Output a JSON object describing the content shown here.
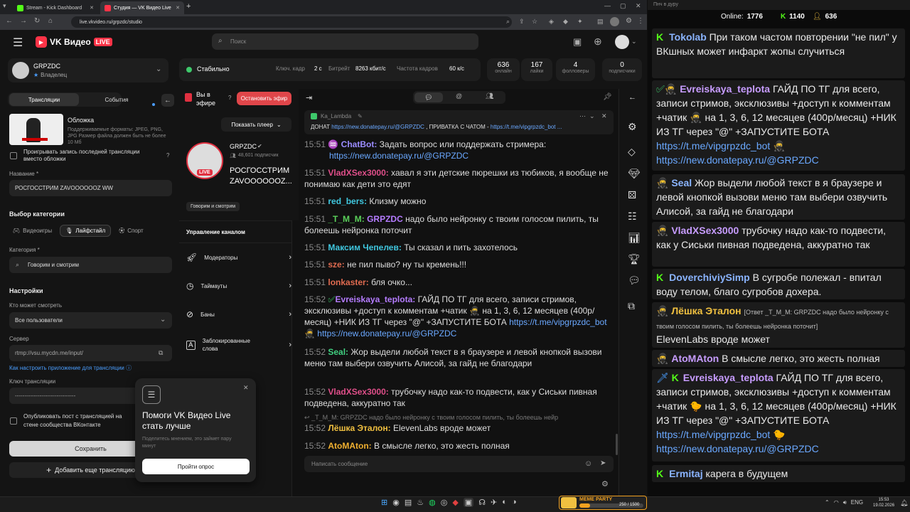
{
  "browser": {
    "tabs": [
      {
        "label": "Stream - Kick Dashboard"
      },
      {
        "label": "Студия — VK Видео Live"
      }
    ],
    "url": "live.vkvideo.ru/grpzdc/studio"
  },
  "header": {
    "logo": "VK Видео",
    "logo_badge": "LIVE",
    "search_placeholder": "Поиск"
  },
  "account": {
    "name": "GRPZDC",
    "role": "Владелец"
  },
  "status": {
    "state": "Стабильно",
    "keyframe_label": "Ключ. кадр",
    "keyframe_value": "2 с",
    "bitrate_label": "Битрейт",
    "bitrate_value": "8263 кбит/с",
    "fps_label": "Частота кадров",
    "fps_value": "60 к/с"
  },
  "stats": [
    {
      "value": "636",
      "label": "онлайн"
    },
    {
      "value": "167",
      "label": "лайки"
    },
    {
      "value": "4",
      "label": "фолловеры"
    },
    {
      "value": "0",
      "label": "подписчики"
    }
  ],
  "left": {
    "tabs": [
      "Трансляции",
      "События"
    ],
    "cover_title": "Обложка",
    "cover_desc": "Поддерживаемые форматы: JPEG, PNG, JPG Размер файла должен быть не более 10 Мб",
    "replay_checkbox": "Проигрывать запись последней трансляции вместо обложки",
    "name_label": "Название *",
    "name_value": "РОСГОССТРИМ ZAVOOOOOOZ WW",
    "category_section": "Выбор категории",
    "cat_tabs": [
      "Видеоигры",
      "Лайфстайл",
      "Спорт"
    ],
    "category_label": "Категория *",
    "category_value": "Говорим и смотрим",
    "settings": "Настройки",
    "who_label": "Кто может смотреть",
    "who_value": "Все пользователи",
    "server_label": "Сервер",
    "server_value": "rtmp://vsu.mycdn.me/input/",
    "howto": "Как настроить приложение для трансляции",
    "key_label": "Ключ трансляции",
    "key_value": "--------------------------------",
    "publish": "Опубликовать пост с трансляцией на стене сообщества ВКонтакте",
    "save": "Сохранить",
    "add": "Добавить еще трансляцию"
  },
  "mid": {
    "live_label": "Вы в эфире",
    "stop": "Остановить эфир",
    "show_player": "Показать плеер",
    "channel": "GRPZDC",
    "subs": "48,601 подписчик",
    "live_badge": "LIVE",
    "title1": "РОСГОССТРИМ",
    "title2": "ZAVOOOOOOZ...",
    "tag": "Говорим и смотрим",
    "manage": "Управление каналом",
    "menu": [
      "Модераторы",
      "Таймауты",
      "Баны",
      "Заблокированные слова"
    ]
  },
  "popup": {
    "title1": "Помоги VK Видео Live",
    "title2": "стать лучше",
    "desc": "Поделитесь мнением, это займет пару минут",
    "button": "Пройти опрос"
  },
  "chat": {
    "pinned_author": "Ka_Lambda",
    "pinned_text1": "ДОНАТ ",
    "pinned_link1": "https://new.donatepay.ru/@GRPZDC",
    "pinned_text2": " , ПРИВАТКА С ЧАТОМ - ",
    "pinned_link2": "https://t.me/vipgrpzdc_bot ...",
    "messages": [
      {
        "time": "15:51",
        "user": "ChatBot:",
        "text": "Задать вопрос или поддержать стримера:",
        "link": "https://new.donatepay.ru/@GRPZDC",
        "color": "#9b8cff"
      },
      {
        "time": "15:51",
        "user": "VladXSex3000:",
        "text": "хавал я эти детские пюрешки из тюбиков, я вообще не понимаю как дети это едят",
        "color": "#e04f8a"
      },
      {
        "time": "15:51",
        "user": "red_bers:",
        "text": "Клизму можно",
        "color": "#40c8e0"
      },
      {
        "time": "15:51",
        "user": "_T_M_M:",
        "mention": "GRPZDC",
        "text": "надо было нейронку с твоим голосом пилить, ты болеешь нейронка поточит",
        "color": "#5ad05a"
      },
      {
        "time": "15:51",
        "user": "Максим Чепелев:",
        "text": "Ты сказал и пить захотелось",
        "color": "#40c8e0"
      },
      {
        "time": "15:51",
        "user": "sze:",
        "text": "не пил пыво? ну ты кремень!!!",
        "color": "#e06b50"
      },
      {
        "time": "15:51",
        "user": "lonkaster:",
        "text": "бля очко...",
        "color": "#e06b50"
      },
      {
        "time": "15:52",
        "user": "Evreiskaya_teplota:",
        "text": "ГАЙД ПО ТГ для всего, записи стримов, эксклюзивы +доступ к комментам +чатик",
        "text2": "на 1, 3, 6, 12 месяцев (400р/месяц) +НИК ИЗ ТГ через \"@\" +ЗАПУСТИТЕ БОТА",
        "link": "https://t.me/vipgrpzdc_bot",
        "link2": "https://new.donatepay.ru/@GRPZDC",
        "color": "#b57cff"
      },
      {
        "time": "15:52",
        "user": "Seal:",
        "text": "Жор выдели любой текст в я браузере и левой кнопкой вызови меню там выбери озвучить Алисой, за гайд не благодари",
        "color": "#40d080"
      },
      {
        "time": "15:52",
        "user": "VladXSex3000:",
        "text": "трубочку надо как-то подвести, как у Сиськи пивная подведена, аккуратно так",
        "color": "#e04f8a"
      },
      {
        "reply": "_T_M_M: GRPZDC надо было нейронку с твоим голосом пилить, ты болеешь нейр"
      },
      {
        "time": "15:52",
        "user": "Лёшка Эталон:",
        "text": "ElevenLabs вроде может",
        "color": "#f0c040"
      },
      {
        "time": "15:52",
        "user": "AtoMAton:",
        "text": "В смысле легко, это жесть полная",
        "color": "#f0b030"
      }
    ],
    "input_placeholder": "Написать сообщение"
  },
  "overlay": {
    "online_label": "Online:",
    "online": "1776",
    "kick": "1140",
    "vk": "636",
    "messages": [
      {
        "user": "Tokolab",
        "text": "При таком частом повторении \"не пил\" у ВКшных может инфаркт жопы случиться",
        "color": "#8ab4ff",
        "badge": "K"
      },
      {
        "user": "Evreiskaya_teplota",
        "text": "ГАЙД ПО ТГ для всего, записи стримов, эксклюзивы +доступ к комментам +чатик",
        "text2": "на 1, 3, 6, 12 месяцев (400р/месяц) +НИК ИЗ ТГ через \"@\" +ЗАПУСТИТЕ БОТА",
        "link": "https://t.me/vipgrpzdc_bot",
        "link2": "https://new.donatepay.ru/@GRPZDC",
        "color": "#c79cff",
        "badge": "VK"
      },
      {
        "user": "Seal",
        "text": "Жор выдели любой текст в я браузере и левой кнопкой вызови меню там выбери озвучить Алисой, за гайд не благодари",
        "color": "#8ab4ff",
        "badge": "VK"
      },
      {
        "user": "VladXSex3000",
        "text": "трубочку надо как-то подвести, как у Сиськи пивная подведена, аккуратно так",
        "color": "#c79cff",
        "badge": "VK"
      },
      {
        "user": "DoverchiviySimp",
        "text": "В сугробе полежал - впитал воду телом, благо сугробов дохера.",
        "color": "#8ab4ff",
        "badge": "K"
      },
      {
        "user": "Лёшка Эталон",
        "reply": "[Ответ _T_M_M: GRPZDC надо было нейронку с твоим голосом пилить, ты болеешь нейронка поточит]",
        "text": "ElevenLabs вроде может",
        "color": "#f0c040",
        "badge": "VK"
      },
      {
        "user": "AtoMAton",
        "text": "В смысле легко, это жесть полная",
        "color": "#c79cff",
        "badge": "VK"
      },
      {
        "user": "Evreiskaya_teplota",
        "text": "ГАЙД ПО ТГ для всего, записи стримов, эксклюзивы +доступ к комментам +чатик",
        "text2": "на 1, 3, 6, 12 месяцев (400р/месяц) +НИК ИЗ ТГ через \"@\" +ЗАПУСТИТЕ БОТА",
        "link": "https://t.me/vipgrpzdc_bot",
        "link2": "https://new.donatepay.ru/@GRPZDC",
        "color": "#c79cff",
        "badge": "K"
      },
      {
        "user": "Ermitaj",
        "text": "карега в будущем",
        "color": "#8ab4ff",
        "badge": "K"
      }
    ]
  },
  "taskbar": {
    "lang": "ENG",
    "time": "15:53",
    "date": "19.02.2026",
    "meme_label": "MEME PARTY",
    "meme_value": "250 / 1500"
  }
}
